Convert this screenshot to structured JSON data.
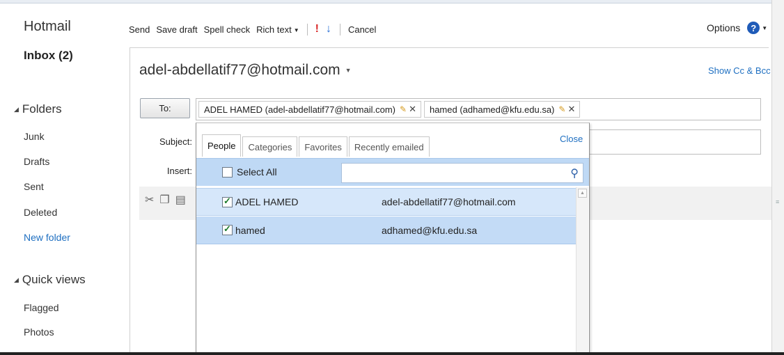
{
  "nav": {
    "brand": "Hotmail",
    "inbox": "Inbox (2)",
    "folders_label": "Folders",
    "folders": [
      "Junk",
      "Drafts",
      "Sent",
      "Deleted"
    ],
    "new_folder": "New folder",
    "quick_views_label": "Quick views",
    "quick_views": [
      "Flagged",
      "Photos"
    ]
  },
  "toolbar": {
    "send": "Send",
    "save_draft": "Save draft",
    "spell_check": "Spell check",
    "rich_text": "Rich text",
    "high_importance": "!",
    "low_importance": "↓",
    "cancel": "Cancel",
    "options": "Options",
    "help": "?"
  },
  "compose": {
    "from": "adel-abdellatif77@hotmail.com",
    "show_cc_bcc": "Show Cc & Bcc",
    "to_button": "To:",
    "recipients": [
      {
        "label": "ADEL HAMED  (adel-abdellatif77@hotmail.com)"
      },
      {
        "label": "hamed  (adhamed@kfu.edu.sa)"
      }
    ],
    "subject_label": "Subject:",
    "insert_label": "Insert:"
  },
  "picker": {
    "tabs": [
      "People",
      "Categories",
      "Favorites",
      "Recently emailed"
    ],
    "active_tab": "People",
    "close": "Close",
    "select_all": "Select All",
    "search_value": "",
    "contacts": [
      {
        "name": "ADEL HAMED",
        "email": "adel-abdellatif77@hotmail.com",
        "checked": true
      },
      {
        "name": "hamed",
        "email": "adhamed@kfu.edu.sa",
        "checked": true
      }
    ]
  },
  "icons": {
    "help": "help-icon",
    "search": "search-icon",
    "cut": "cut-icon",
    "copy": "copy-icon",
    "paste": "paste-icon",
    "edit": "pencil-icon",
    "remove": "close-icon"
  },
  "colors": {
    "link": "#1e6fc1",
    "selection": "#c3dbf6",
    "importance_high": "#d92a2a",
    "importance_low": "#2a6fd6"
  }
}
